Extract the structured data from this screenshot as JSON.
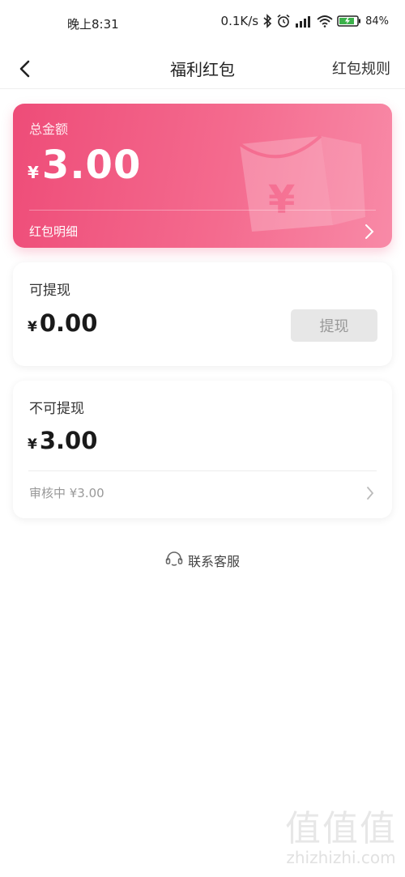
{
  "status_bar": {
    "time": "晚上8:31",
    "net_speed": "0.1K/s",
    "battery": "84%",
    "icons": [
      "bluetooth-icon",
      "alarm-icon",
      "signal-icon",
      "wifi-icon",
      "battery-icon"
    ]
  },
  "nav": {
    "title": "福利红包",
    "rule_link": "红包规则"
  },
  "total": {
    "label": "总金额",
    "currency": "¥",
    "amount": "3.00",
    "detail_label": "红包明细"
  },
  "withdrawable": {
    "label": "可提现",
    "currency": "¥",
    "amount": "0.00",
    "button_label": "提现"
  },
  "non_withdrawable": {
    "label": "不可提现",
    "currency": "¥",
    "amount": "3.00",
    "review_text": "审核中 ¥3.00"
  },
  "service": {
    "label": "联系客服"
  },
  "watermark": {
    "glyphs": "值值值",
    "text": "zhizhizhi.com"
  },
  "colors": {
    "card_gradient_start": "#ee4c78",
    "card_gradient_end": "#f88aa7",
    "button_disabled_bg": "#e7e7e7",
    "button_disabled_text": "#999999"
  }
}
